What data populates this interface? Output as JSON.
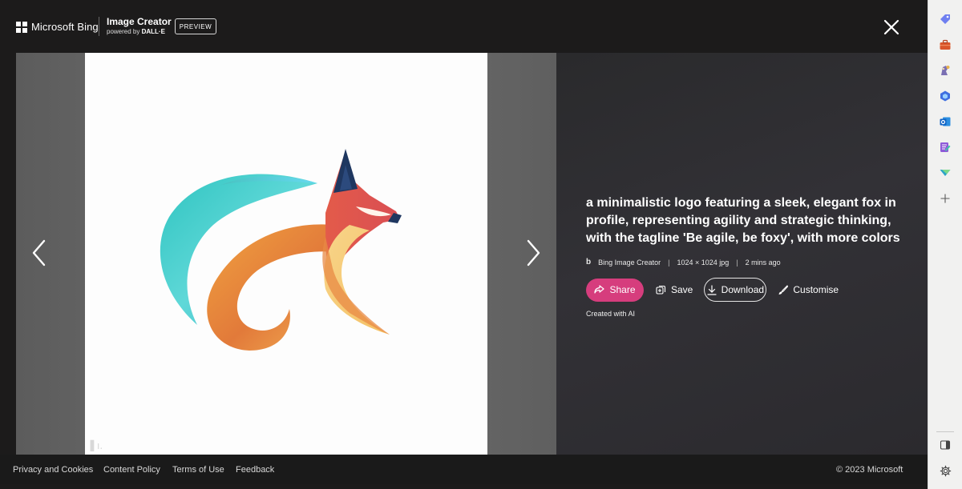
{
  "header": {
    "brand": "Microsoft Bing",
    "title": "Image Creator",
    "subtitle_prefix": "powered by ",
    "subtitle_brand": "DALL·E",
    "badge": "PREVIEW"
  },
  "details": {
    "prompt": "a minimalistic logo featuring a sleek, elegant fox in profile, representing agility and strategic thinking, with the tagline 'Be agile, be foxy', with more colors",
    "source": "Bing Image Creator",
    "dimensions": "1024 × 1024 jpg",
    "age": "2 mins ago",
    "share_label": "Share",
    "save_label": "Save",
    "download_label": "Download",
    "customise_label": "Customise",
    "created_note": "Created with AI"
  },
  "footer": {
    "links": [
      "Privacy and Cookies",
      "Content Policy",
      "Terms of Use",
      "Feedback"
    ],
    "copyright": "© 2023 Microsoft"
  },
  "sidebar": {
    "icons": [
      "tag-icon",
      "briefcase-icon",
      "games-icon",
      "copilot-icon",
      "outlook-icon",
      "designer-icon",
      "drop-icon",
      "add-icon",
      "split-screen-icon",
      "gear-icon"
    ]
  },
  "colors": {
    "share_accent": "#d63d7d",
    "background": "#1c1b1b",
    "sidebar": "#f1f1f0"
  }
}
